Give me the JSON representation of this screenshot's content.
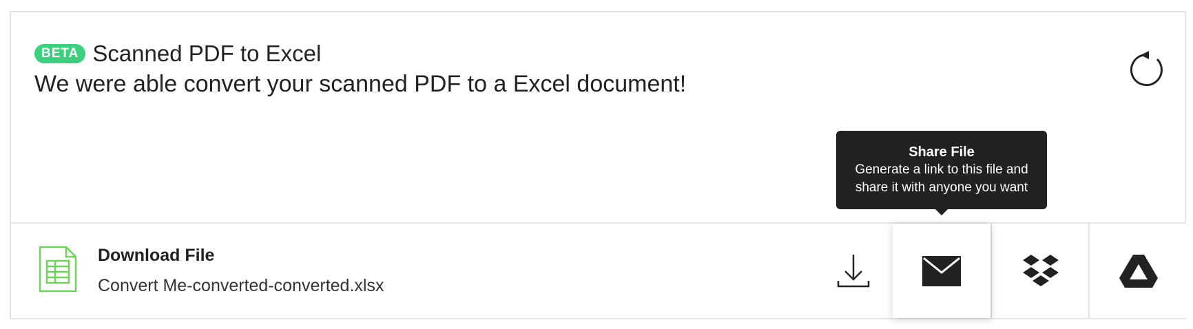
{
  "header": {
    "badge": "BETA",
    "title": "Scanned PDF to Excel",
    "subtitle": "We were able convert your scanned PDF to a Excel document!"
  },
  "file": {
    "label": "Download File",
    "name": "Convert Me-converted-converted.xlsx"
  },
  "tooltip": {
    "title": "Share File",
    "line1": "Generate a link to this file and",
    "line2": "share it with anyone you want"
  },
  "actions": [
    {
      "name": "download",
      "icon": "download-icon"
    },
    {
      "name": "email",
      "icon": "envelope-icon"
    },
    {
      "name": "dropbox",
      "icon": "dropbox-icon"
    },
    {
      "name": "google-drive",
      "icon": "google-drive-icon"
    }
  ],
  "colors": {
    "beta_badge": "#3ccf7e",
    "excel_icon": "#6fd35b",
    "tooltip_bg": "#222222",
    "border": "#e3e3e3"
  }
}
